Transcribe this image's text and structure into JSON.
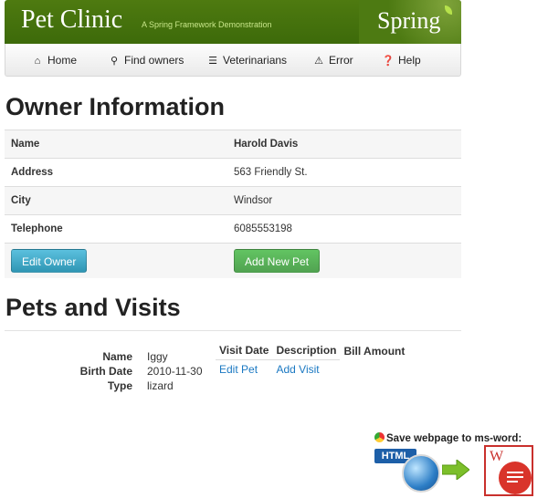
{
  "banner": {
    "logo": "Pet Clinic",
    "tagline": "A Spring Framework Demonstration",
    "brand": "Spring"
  },
  "nav": {
    "items": [
      {
        "label": "Home",
        "icon": "home-icon"
      },
      {
        "label": "Find owners",
        "icon": "search-icon"
      },
      {
        "label": "Veterinarians",
        "icon": "list-icon"
      },
      {
        "label": "Error",
        "icon": "warning-icon"
      },
      {
        "label": "Help",
        "icon": "help-icon"
      }
    ]
  },
  "owner": {
    "heading": "Owner Information",
    "rows": [
      {
        "label": "Name",
        "value": "Harold Davis"
      },
      {
        "label": "Address",
        "value": "563 Friendly St."
      },
      {
        "label": "City",
        "value": "Windsor"
      },
      {
        "label": "Telephone",
        "value": "6085553198"
      }
    ],
    "edit_button": "Edit Owner",
    "add_pet_button": "Add New Pet"
  },
  "pets": {
    "heading": "Pets and Visits",
    "pet": {
      "name_label": "Name",
      "name": "Iggy",
      "birth_label": "Birth Date",
      "birth_date": "2010-11-30",
      "type_label": "Type",
      "type": "lizard"
    },
    "visits": {
      "headers": [
        "Visit Date",
        "Description",
        "Bill Amount"
      ],
      "edit_pet": "Edit Pet",
      "add_visit": "Add Visit"
    }
  },
  "widget": {
    "caption": "Save webpage to ms-word:",
    "html_badge": "HTML",
    "doc_letter": "W"
  },
  "colors": {
    "banner": "#4e7a10",
    "link": "#1a78c2",
    "button_blue": "#2f96b4",
    "button_green": "#51a351"
  }
}
